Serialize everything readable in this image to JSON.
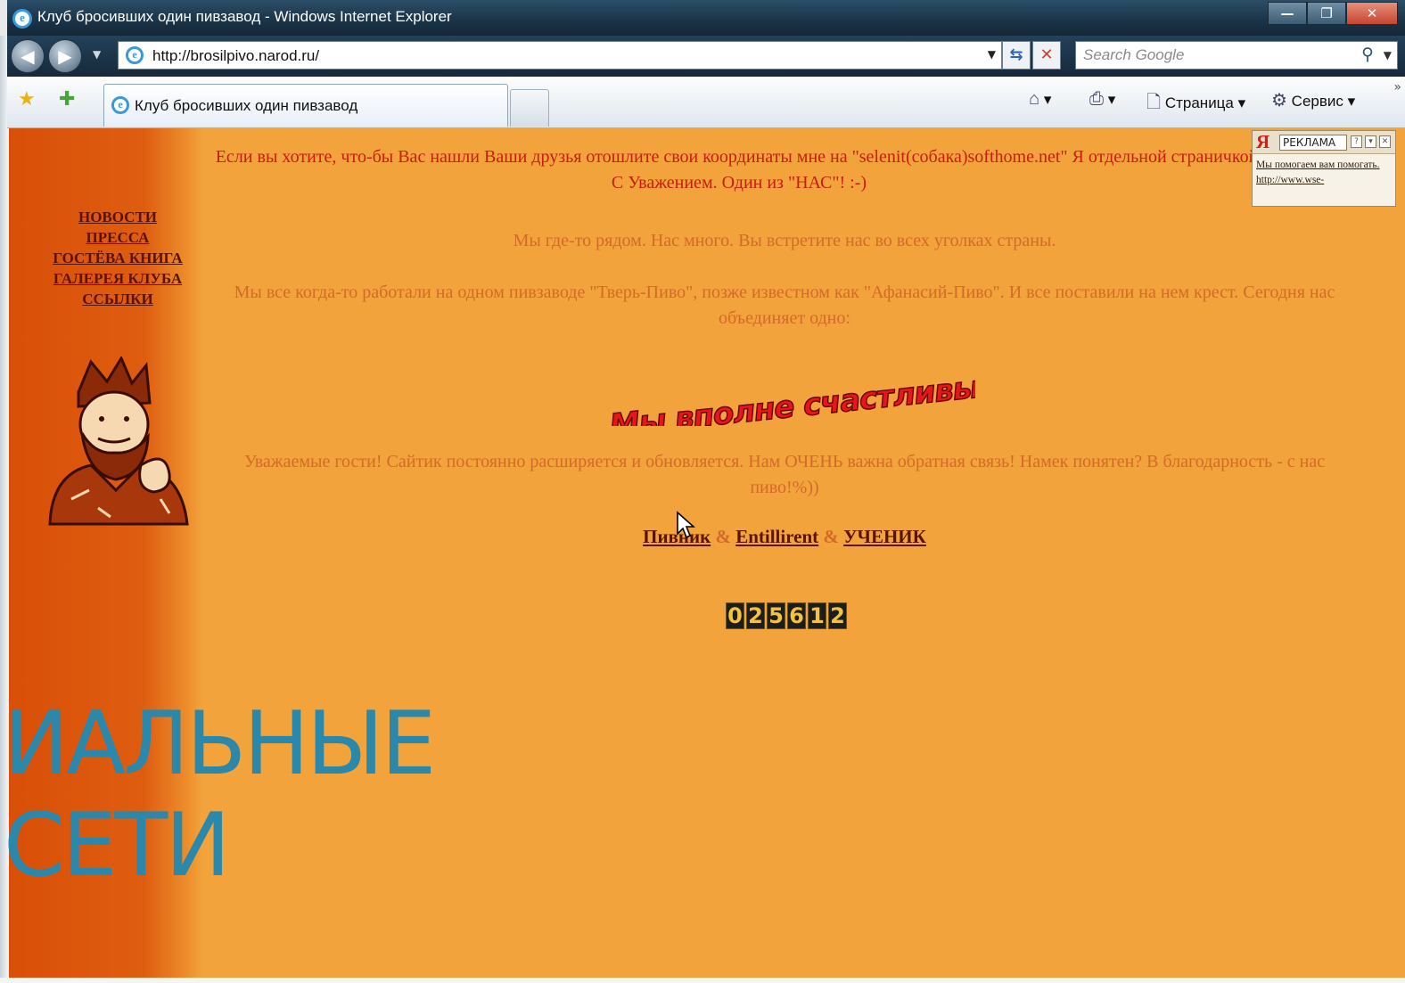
{
  "window": {
    "title": "Клуб бросивших один пивзавод - Windows Internet Explorer",
    "minimize": "—",
    "maximize": "❐",
    "close": "✕"
  },
  "address_bar": {
    "url": "http://brosilpivo.narod.ru/",
    "search_placeholder": "Search Google"
  },
  "tab": {
    "label": "Клуб бросивших один пивзавод"
  },
  "command_bar": {
    "page_label": "Страница",
    "tools_label": "Сервис"
  },
  "sidebar": {
    "nav": [
      {
        "label": "НОВОСТИ"
      },
      {
        "label": "ПРЕССА"
      },
      {
        "label": "ГОСТЁВА КНИГА"
      },
      {
        "label": "ГАЛЕРЕЯ КЛУБА"
      },
      {
        "label": "ССЫЛКИ"
      }
    ]
  },
  "content": {
    "notice": "Если вы хотите, что-бы Вас нашли Ваши друзья отошлите свои координаты мне на \"selenit(собака)softhome.net\" Я отдельной страничкой. С Уважением. Один из \"НАС\"! :-)",
    "intro": "Мы где-то рядом. Нас много. Вы встретите нас во всех уголках страны.",
    "story": "Мы все когда-то работали на одном пивзаводе \"Тверь-Пиво\", позже известном как \"Афанасий-Пиво\". И все поставили на нем крест. Сегодня нас объединяет одно:",
    "slogan": "Мы вполне счастливы!",
    "guests": "Уважаемые гости! Сайтик постоянно расширяется и обновляется. Нам ОЧЕНЬ важна обратная связь! Намек понятен? В благодарность - с нас пиво!%))",
    "authors": [
      {
        "label": "Пивник"
      },
      {
        "label": "Entillirent"
      },
      {
        "label": "УЧЕНИК"
      }
    ],
    "separator": "&",
    "counter": [
      "0",
      "2",
      "5",
      "6",
      "1",
      "2"
    ]
  },
  "ad": {
    "logo": "Я",
    "label": "РЕКЛАМА",
    "text": "Мы помогаем вам помогать. http://www.wse-"
  },
  "slide_overlay": {
    "line1": "ИАЛЬНЫЕ",
    "line2": "СЕТИ"
  },
  "colors": {
    "page_bg": "#f2a33b",
    "sidebar": "#d94f08",
    "link": "#5a1203",
    "notice": "#c81d0e",
    "overlay_text": "#2b88aa"
  }
}
